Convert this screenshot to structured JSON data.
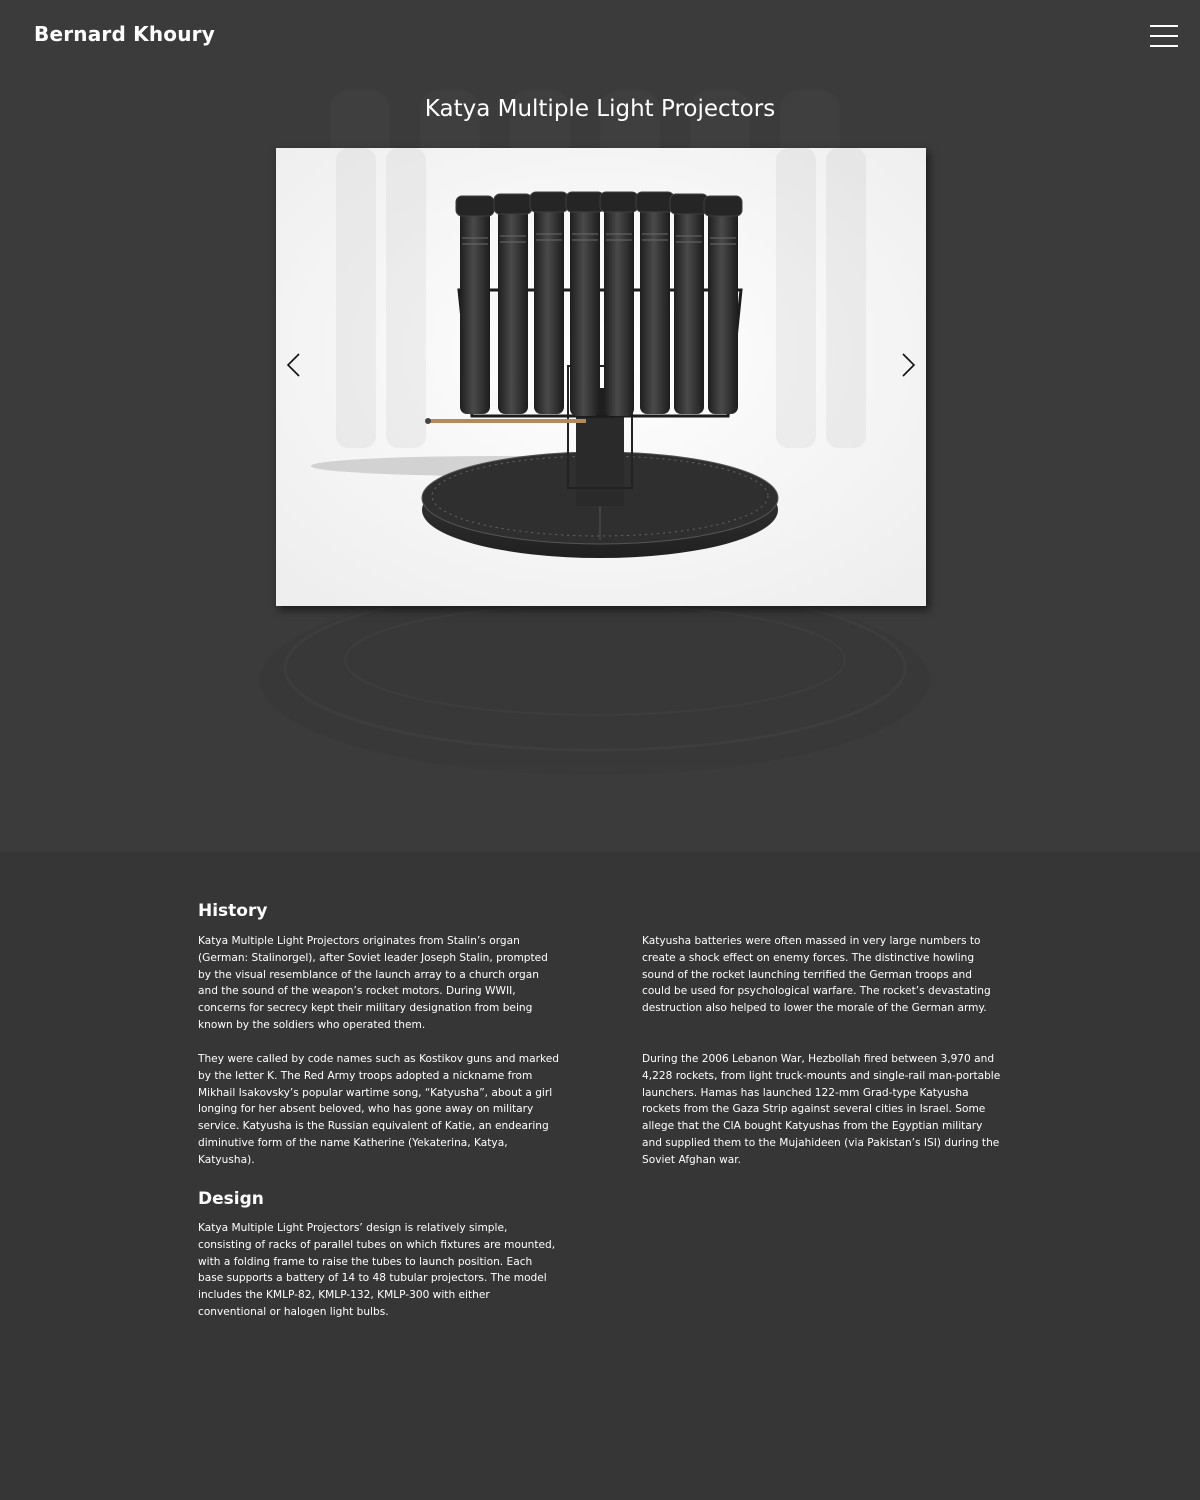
{
  "header": {
    "logo": "Bernard Khoury",
    "menu_icon": "hamburger-menu-icon"
  },
  "project": {
    "title": "Katya Multiple Light Projectors"
  },
  "gallery": {
    "prev_icon": "chevron-left-icon",
    "next_icon": "chevron-right-icon"
  },
  "sections": {
    "history": {
      "heading": "History",
      "paragraphs": [
        "Katya Multiple Light Projectors originates from Stalin’s organ (German: Stalinorgel), after Soviet leader Joseph Stalin, prompted by the visual resemblance of the launch array to a church organ and the sound of the weapon’s rocket motors. During WWII, concerns for secrecy kept their military designation from being known by the soldiers who operated them.",
        "They were called by code names such as Kostikov guns and marked by the letter K. The Red Army troops adopted a nickname from Mikhail Isakovsky’s popular wartime song, “Katyusha”, about a girl longing for her absent beloved, who has gone away on military service. Katyusha is the Russian equivalent of Katie, an endearing diminutive form of the name Katherine (Yekaterina, Katya, Katyusha).",
        "Katyusha batteries were often massed in very large numbers to create a shock effect on enemy forces. The distinctive howling sound of the rocket launching terrified the German troops and could be used for psychological warfare. The rocket’s devastating destruction also helped to lower the morale of the German army.",
        "During the 2006 Lebanon War, Hezbollah fired between 3,970 and 4,228 rockets, from light truck-mounts and single-rail man-portable launchers. Hamas has launched 122-mm Grad-type Katyusha rockets from the Gaza Strip against several cities in Israel. Some allege that the CIA bought Katyushas from the Egyptian military and supplied them to the Mujahideen (via Pakistan’s ISI) during the Soviet Afghan war."
      ]
    },
    "design": {
      "heading": "Design",
      "paragraphs": [
        "Katya Multiple Light Projectors’ design is relatively simple, consisting of racks of parallel tubes on which fixtures are mounted, with a folding frame to raise the tubes to launch position. Each base supports a battery of 14 to 48 tubular projectors. The model includes the KMLP-82, KMLP-132, KMLP-300 with either conventional or halogen light bulbs."
      ]
    }
  },
  "colors": {
    "hero_bg": "#3b3b3b",
    "page_bg": "#363636",
    "text": "#ffffff",
    "product_dark": "#2e2e2e"
  }
}
